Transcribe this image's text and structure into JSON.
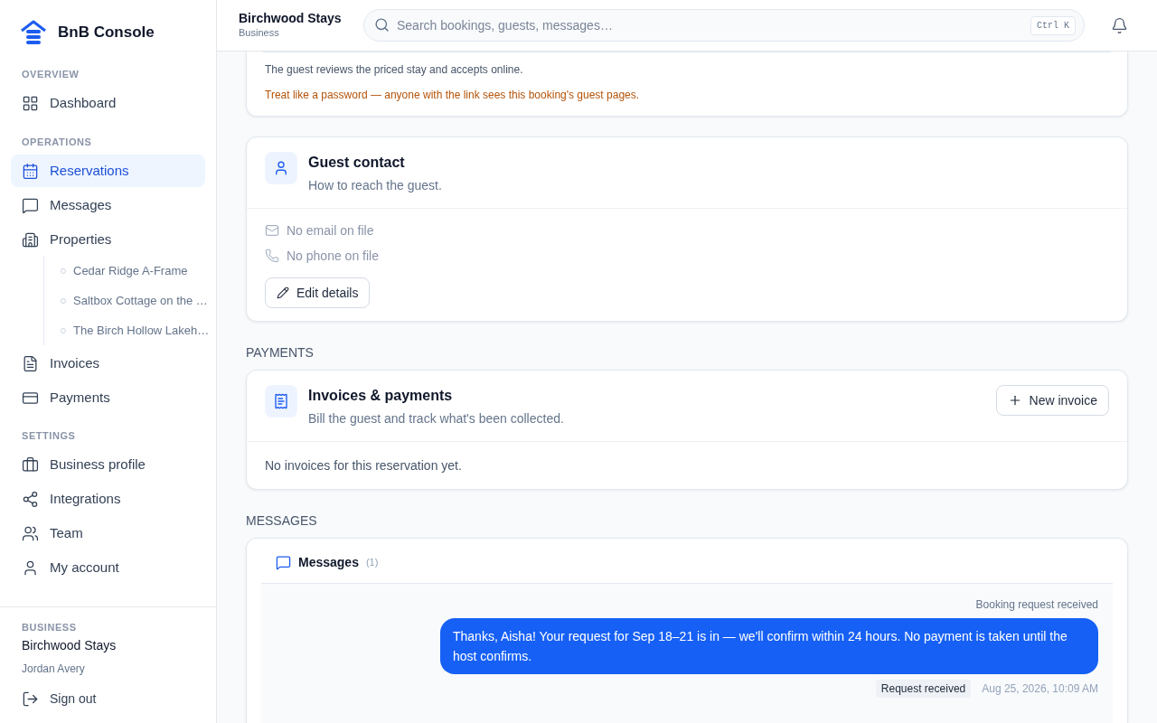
{
  "brand": {
    "name": "BnB Console"
  },
  "sidebar": {
    "sections": [
      {
        "title": "OVERVIEW",
        "items": [
          {
            "label": "Dashboard",
            "selected": false
          }
        ]
      },
      {
        "title": "OPERATIONS",
        "items": [
          {
            "label": "Reservations",
            "selected": true
          },
          {
            "label": "Messages",
            "selected": false
          },
          {
            "label": "Properties",
            "selected": false,
            "children": [
              {
                "label": "Cedar Ridge A-Frame",
                "selected": false
              },
              {
                "label": "Saltbox Cottage on the …",
                "selected": false
              },
              {
                "label": "The Birch Hollow Lakeh…",
                "selected": false
              }
            ]
          },
          {
            "label": "Invoices",
            "selected": false
          },
          {
            "label": "Payments",
            "selected": false
          }
        ]
      },
      {
        "title": "SETTINGS",
        "items": [
          {
            "label": "Business profile",
            "selected": false
          },
          {
            "label": "Integrations",
            "selected": false
          },
          {
            "label": "Team",
            "selected": false
          },
          {
            "label": "My account",
            "selected": false
          }
        ]
      }
    ],
    "footer": {
      "label": "BUSINESS",
      "business": "Birchwood Stays",
      "user": "Jordan Avery",
      "sign_out": "Sign out"
    }
  },
  "header": {
    "title": "Birchwood Stays",
    "subtitle": "Business",
    "search": {
      "placeholder": "Search bookings, guests, messages…",
      "shortcut": "Ctrl K"
    }
  },
  "link_card": {
    "note": "The guest reviews the priced stay and accepts online.",
    "warning": "Treat like a password — anyone with the link sees this booking's guest pages."
  },
  "guest_contact": {
    "title": "Guest contact",
    "subtitle": "How to reach the guest.",
    "email": "No email on file",
    "phone": "No phone on file",
    "edit_button": "Edit details"
  },
  "payments": {
    "section": "PAYMENTS",
    "title": "Invoices & payments",
    "subtitle": "Bill the guest and track what's been collected.",
    "new_button": "New invoice",
    "empty": "No invoices for this reservation yet."
  },
  "messages": {
    "section": "MESSAGES",
    "title": "Messages",
    "count": "(1)",
    "items": [
      {
        "event": "Booking request received",
        "text": "Thanks, Aisha! Your request for Sep 18–21 is in — we'll confirm within 24 hours. No payment is taken until the host confirms.",
        "status": "Request received",
        "time": "Aug 25, 2026, 10:09 AM"
      }
    ]
  }
}
